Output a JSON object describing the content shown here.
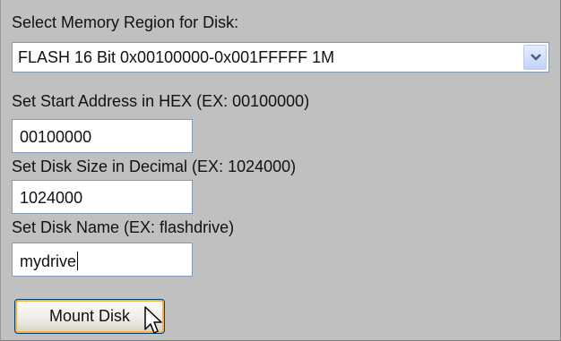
{
  "memory_region": {
    "label": "Select Memory Region for Disk:",
    "selected": "FLASH 16 Bit 0x00100000-0x001FFFFF 1M"
  },
  "start_address": {
    "label": "Set Start Address in HEX (EX: 00100000)",
    "value": "00100000"
  },
  "disk_size": {
    "label": "Set Disk Size in Decimal (EX: 1024000)",
    "value": "1024000"
  },
  "disk_name": {
    "label": "Set Disk Name (EX: flashdrive)",
    "value": "mydrive"
  },
  "mount_button": {
    "label": "Mount Disk"
  },
  "icons": {
    "dropdown": "chevron-down-icon",
    "pointer": "mouse-pointer-icon"
  },
  "colors": {
    "panel_background": "#c0c0c0",
    "input_border": "#7f9db9",
    "button_focus_ring": "#f8b33c",
    "dropdown_arrow": "#4d6185"
  }
}
